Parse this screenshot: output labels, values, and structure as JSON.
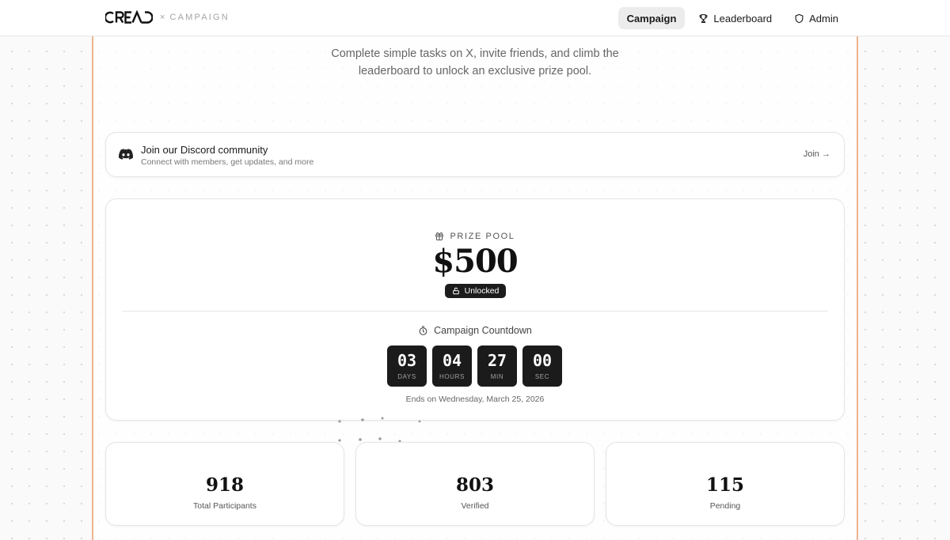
{
  "header": {
    "brand_x": "×",
    "brand_sub": "CAMPAIGN",
    "nav": [
      {
        "label": "Campaign",
        "icon": "none",
        "active": true
      },
      {
        "label": "Leaderboard",
        "icon": "trophy-icon",
        "active": false
      },
      {
        "label": "Admin",
        "icon": "shield-icon",
        "active": false
      }
    ]
  },
  "hero": {
    "line1": "Complete simple tasks on X, invite friends, and climb the",
    "line2": "leaderboard to unlock an exclusive prize pool."
  },
  "discord": {
    "icon": "discord-icon",
    "title": "Join our Discord community",
    "subtitle": "Connect with members, get updates, and more",
    "join_label": "Join →"
  },
  "prize": {
    "label": "PRIZE POOL",
    "amount": "$500",
    "badge": "Unlocked",
    "countdown_title": "Campaign Countdown",
    "countdown": [
      {
        "value": "03",
        "unit": "DAYS"
      },
      {
        "value": "04",
        "unit": "HOURS"
      },
      {
        "value": "27",
        "unit": "MIN"
      },
      {
        "value": "00",
        "unit": "SEC"
      }
    ],
    "ends_on": "Ends on Wednesday, March 25, 2026"
  },
  "stats": [
    {
      "value": "918",
      "label": "Total Participants"
    },
    {
      "value": "803",
      "label": "Verified"
    },
    {
      "value": "115",
      "label": "Pending"
    }
  ],
  "colors": {
    "accent_line": "#f0b490",
    "dark": "#1b1b1b"
  }
}
